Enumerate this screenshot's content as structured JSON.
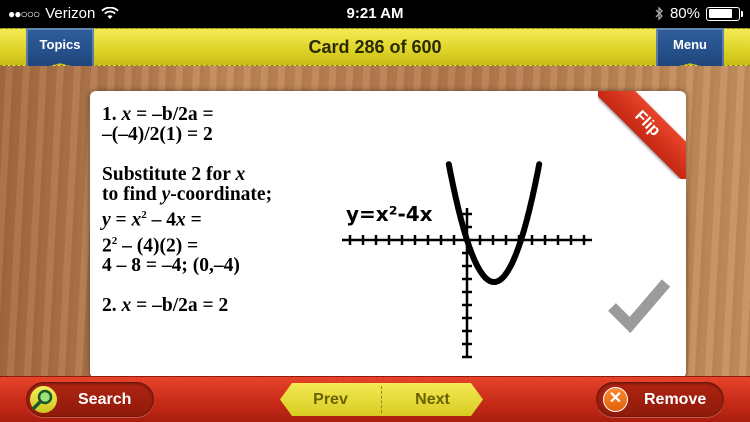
{
  "status_bar": {
    "carrier": "Verizon",
    "signal": "●●○○○",
    "time": "9:21 AM",
    "battery": "80%",
    "battery_level": 0.8
  },
  "header": {
    "title": "Card 286 of 600",
    "left_ribbon": "Topics",
    "right_ribbon": "Menu"
  },
  "card": {
    "flip_label": "Flip",
    "graph_label": "y=x²-4x"
  },
  "bottom_bar": {
    "search_label": "Search",
    "prev_label": "Prev",
    "next_label": "Next",
    "remove_label": "Remove"
  },
  "colors": {
    "header_yellow": "#e0d52a",
    "ribbon_blue": "#1d4278",
    "bottom_red": "#c52a17",
    "flip_red": "#d2301a"
  }
}
